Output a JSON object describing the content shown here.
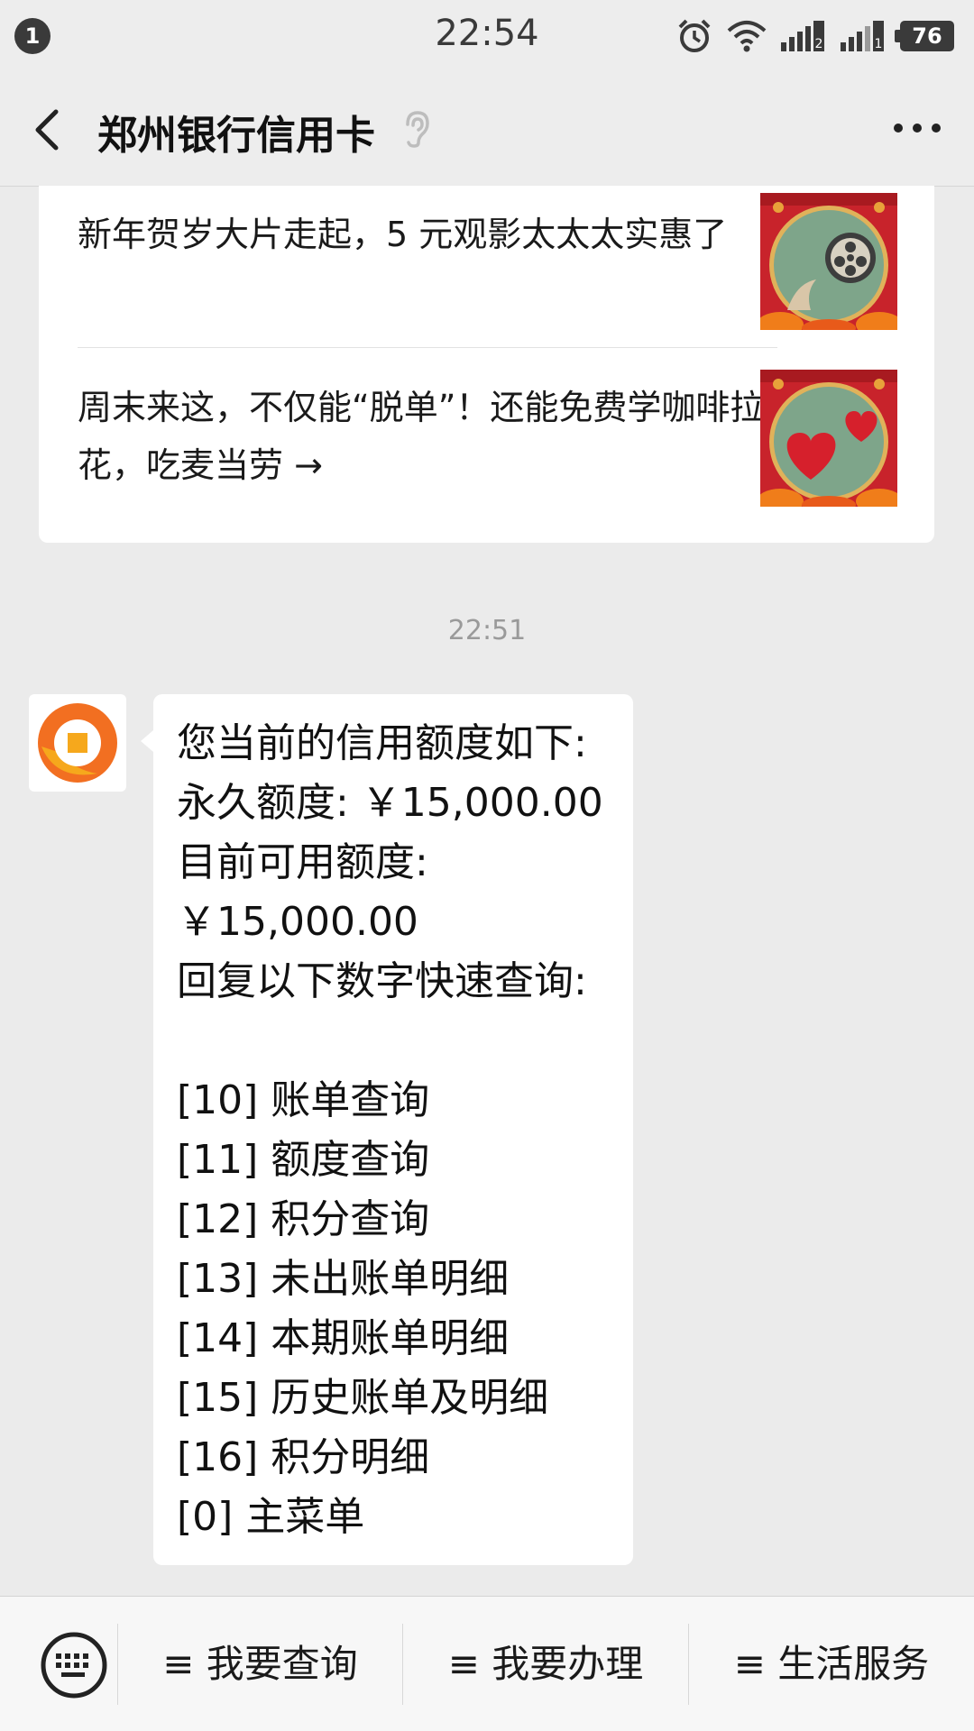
{
  "status_bar": {
    "notification_count": "1",
    "time": "22:54",
    "battery": "76",
    "sim1_label": "2",
    "sim2_label": "1"
  },
  "header": {
    "title": "郑州银行信用卡"
  },
  "articles": [
    {
      "text": "新年贺岁大片走起，5 元观影太太太实惠了",
      "thumb_icon": "film-reel-icon"
    },
    {
      "text": "周末来这，不仅能“脱单”！还能免费学咖啡拉花，吃麦当劳 →",
      "thumb_icon": "hearts-icon"
    }
  ],
  "timestamp": "22:51",
  "message": {
    "lines": [
      "您当前的信用额度如下:",
      "永久额度: ￥15,000.00",
      "目前可用额度:",
      "￥15,000.00",
      "回复以下数字快速查询:",
      "",
      "[10]  账单查询",
      "[11]  额度查询",
      "[12]  积分查询",
      "[13]  未出账单明细",
      "[14]  本期账单明细",
      "[15]  历史账单及明细",
      "[16]  积分明细",
      "[0] 主菜单"
    ]
  },
  "bottom_menu": {
    "items": [
      "≡ 我要查询",
      "≡ 我要办理",
      "≡ 生活服务"
    ]
  },
  "colors": {
    "background": "#ebebeb",
    "logo_orange": "#f26f21",
    "logo_yellow": "#f6a81c",
    "thumb_red": "#c8232b",
    "thumb_green": "#7ea58a"
  }
}
